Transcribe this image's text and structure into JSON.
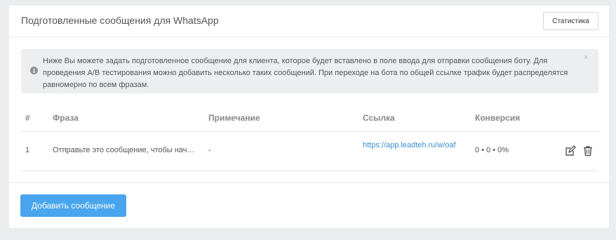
{
  "header": {
    "title": "Подготовленные сообщения для WhatsApp",
    "stats_button": "Статистика"
  },
  "alert": {
    "icon": "info-icon",
    "text": "Ниже Вы можете задать подготовленное сообщение для клиента, которое будет вставлено в поле ввода для отправки сообщения боту. Для проведения A/B тестирования можно добавить несколько таких сообщений. При переходе на бота по общей ссылке трафик будет распределятся равномерно по всем фразам.",
    "close": "×"
  },
  "table": {
    "columns": [
      "#",
      "Фраза",
      "Примечание",
      "Ссылка",
      "Конверсия"
    ],
    "rows": [
      {
        "num": "1",
        "phrase": "Отправьте это сообщение, чтобы начать",
        "note": "-",
        "link": "https://app.leadteh.ru/w/oaf",
        "conversion": "0 • 0 • 0%"
      }
    ]
  },
  "footer": {
    "add_button": "Добавить сообщение"
  },
  "colors": {
    "accent": "#49a5ee",
    "link": "#3a8fcd",
    "background": "#ebedee"
  }
}
